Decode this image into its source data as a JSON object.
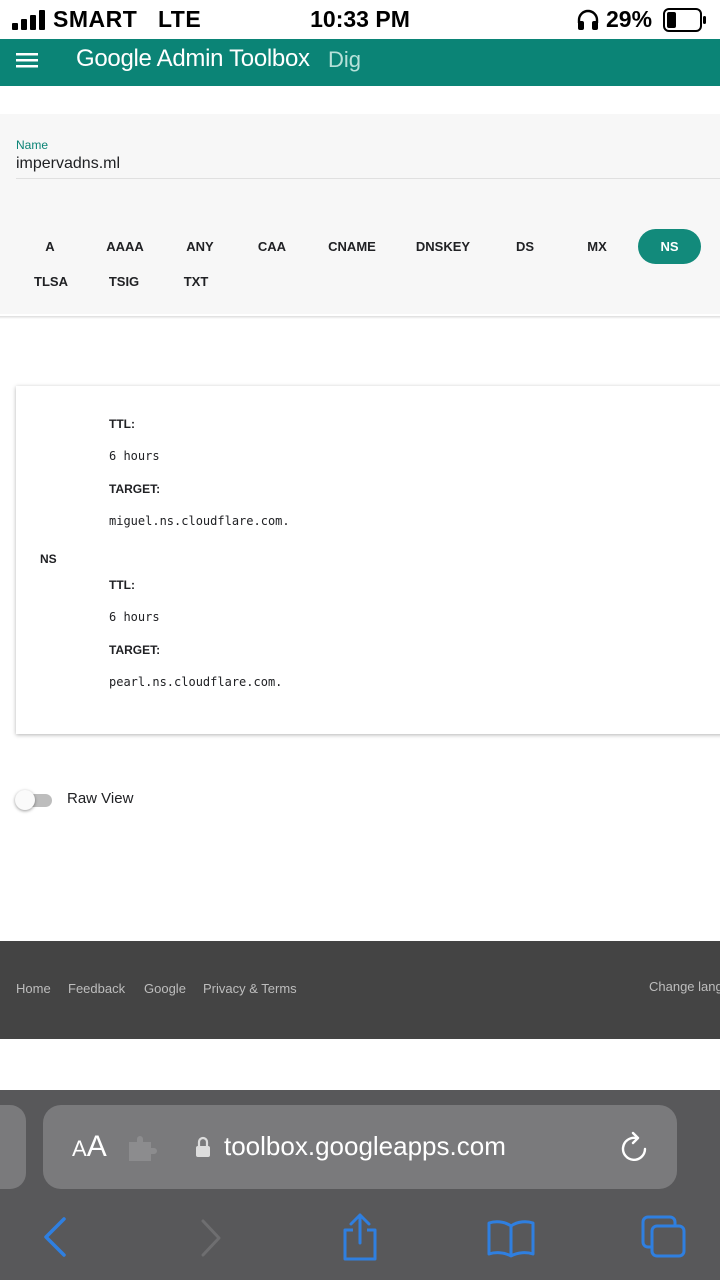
{
  "status_bar": {
    "carrier": "SMART",
    "network": "LTE",
    "time": "10:33 PM",
    "battery_pct": "29%",
    "battery_level": 0.29
  },
  "app_bar": {
    "title": "Google Admin Toolbox",
    "subtitle": "Dig"
  },
  "query": {
    "name_label": "Name",
    "name_value": "impervadns.ml"
  },
  "record_types": [
    "A",
    "AAAA",
    "ANY",
    "CAA",
    "CNAME",
    "DNSKEY",
    "DS",
    "MX",
    "NS",
    "TLSA",
    "TSIG",
    "TXT"
  ],
  "selected_type": "NS",
  "results": {
    "type": "NS",
    "records": [
      {
        "ttl_label": "TTL:",
        "ttl": "6 hours",
        "target_label": "TARGET:",
        "target": "miguel.ns.cloudflare.com."
      },
      {
        "ttl_label": "TTL:",
        "ttl": "6 hours",
        "target_label": "TARGET:",
        "target": "pearl.ns.cloudflare.com."
      }
    ]
  },
  "raw_view": {
    "label": "Raw View",
    "enabled": false
  },
  "footer": {
    "links": [
      "Home",
      "Feedback",
      "Google",
      "Privacy & Terms"
    ],
    "change_language": "Change language"
  },
  "browser": {
    "aa_small": "A",
    "aa_big": "A",
    "url": "toolbox.googleapps.com"
  },
  "colors": {
    "accent": "#0b8476",
    "chip_active": "#128a7b",
    "footer_bg": "#444444",
    "ios_blue": "#2f7fe0"
  },
  "icons": [
    "signal-icon",
    "headphones-icon",
    "battery-icon",
    "menu-icon",
    "puzzle-icon",
    "lock-icon",
    "reload-icon",
    "back-icon",
    "forward-icon",
    "share-icon",
    "bookmarks-icon",
    "tabs-icon"
  ]
}
